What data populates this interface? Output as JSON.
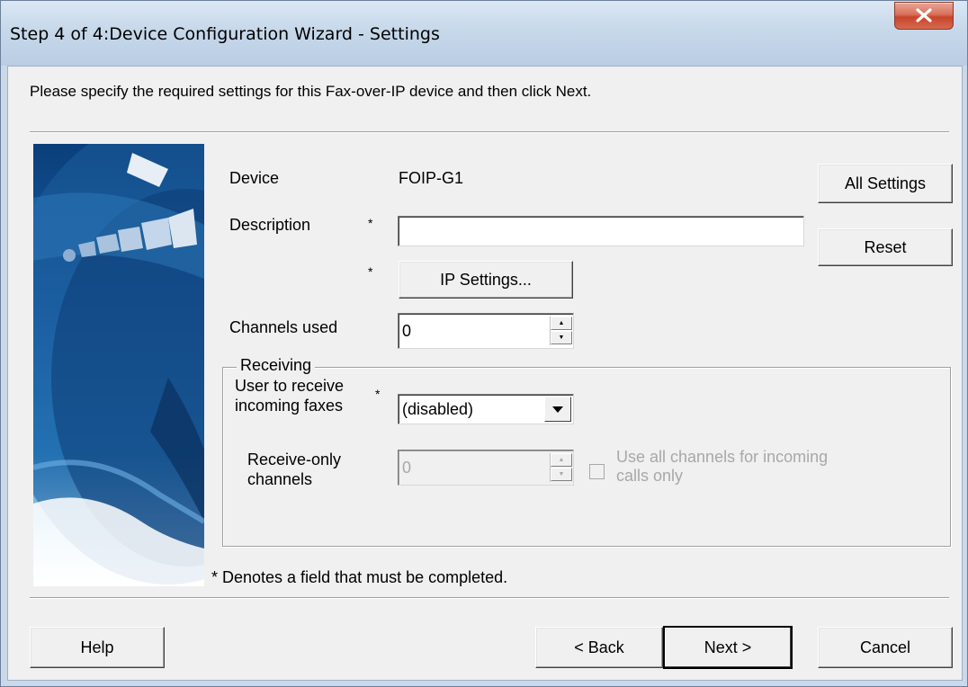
{
  "window": {
    "title": "Step 4 of 4:Device Configuration Wizard - Settings",
    "close_label": "X"
  },
  "instruction": "Please specify the required settings for this Fax-over-IP device and then click Next.",
  "form": {
    "device_label": "Device",
    "device_value": "FOIP-G1",
    "description_label": "Description",
    "description_value": "",
    "required_marker": "*",
    "ip_settings_button": "IP Settings...",
    "channels_used_label": "Channels used",
    "channels_used_value": "0"
  },
  "side_buttons": {
    "all_settings": "All Settings",
    "reset": "Reset"
  },
  "receiving": {
    "group_label": "Receiving",
    "user_label_line1": "User to receive",
    "user_label_line2": "incoming faxes",
    "user_selected": "(disabled)",
    "receive_only_line1": "Receive-only",
    "receive_only_line2": "channels",
    "receive_only_value": "0",
    "use_all_line1": "Use all channels for incoming",
    "use_all_line2": "calls only"
  },
  "footnote": "* Denotes a field that must be completed.",
  "footer": {
    "help": "Help",
    "back": "< Back",
    "next": "Next >",
    "cancel": "Cancel"
  },
  "icons": {
    "close": "close-icon",
    "spin_up": "spin-up-icon",
    "spin_down": "spin-down-icon",
    "dropdown": "chevron-down-icon"
  },
  "colors": {
    "title_bar": "#c7d8ea",
    "close_button": "#c7452c",
    "dialog_bg": "#f0f0f0",
    "disabled_text": "#a8a8a8"
  }
}
